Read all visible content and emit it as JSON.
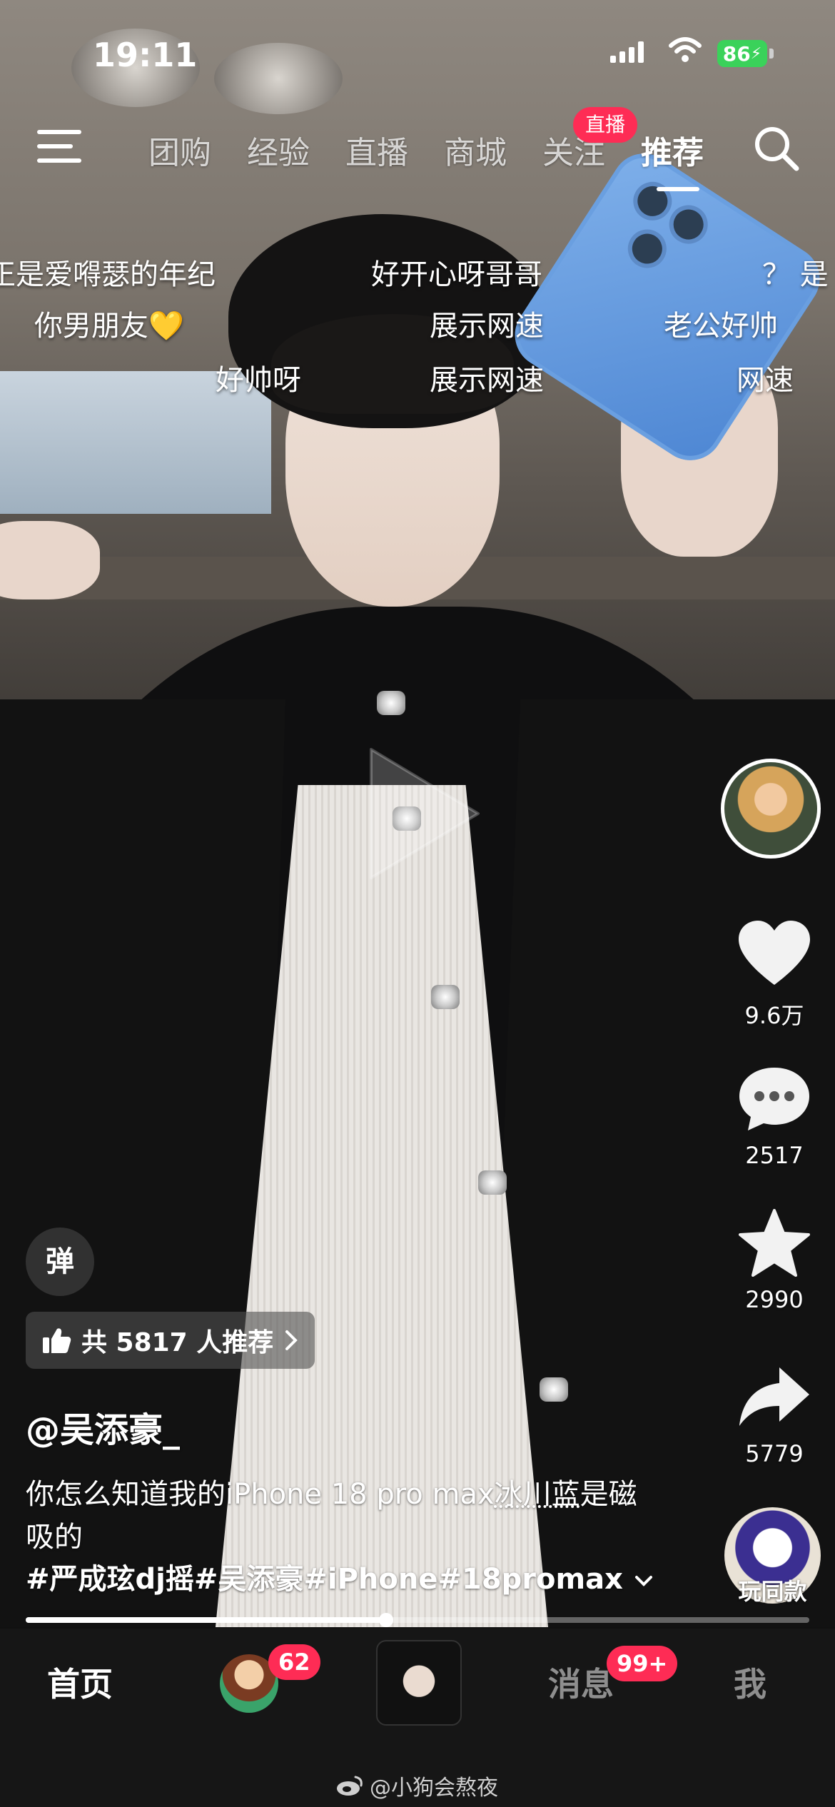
{
  "status_bar": {
    "time": "19:11",
    "battery": "86"
  },
  "top_nav": {
    "tabs": [
      "团购",
      "经验",
      "直播",
      "商城",
      "关注",
      "推荐"
    ],
    "active_tab": "推荐",
    "live_badge": "直播"
  },
  "danmaku": [
    "正是爱嘚瑟的年纪",
    "好开心呀哥哥",
    "？ 是",
    "你男朋友💛",
    "展示网速",
    "老公好帅",
    "好帅呀",
    "展示网速",
    "网速"
  ],
  "rail": {
    "likes": "9.6万",
    "comments": "2517",
    "favorites": "2990",
    "shares": "5779",
    "same_style": "玩同款"
  },
  "video_info": {
    "danmu_toggle": "弹",
    "recommend": "共 5817 人推荐",
    "author": "@吴添豪_",
    "caption_pre": "你怎么知道我的iPhone 18 pro max",
    "caption_highlight": "冰川蓝",
    "caption_post": "是磁吸的",
    "hashtags": "#严成玹dj摇#吴添豪#iPhone#18promax",
    "progress": 0.46
  },
  "tab_bar": {
    "home": "首页",
    "friends_badge": "62",
    "messages": "消息",
    "messages_badge": "99+",
    "me": "我"
  },
  "watermark": "@小狗会熬夜"
}
